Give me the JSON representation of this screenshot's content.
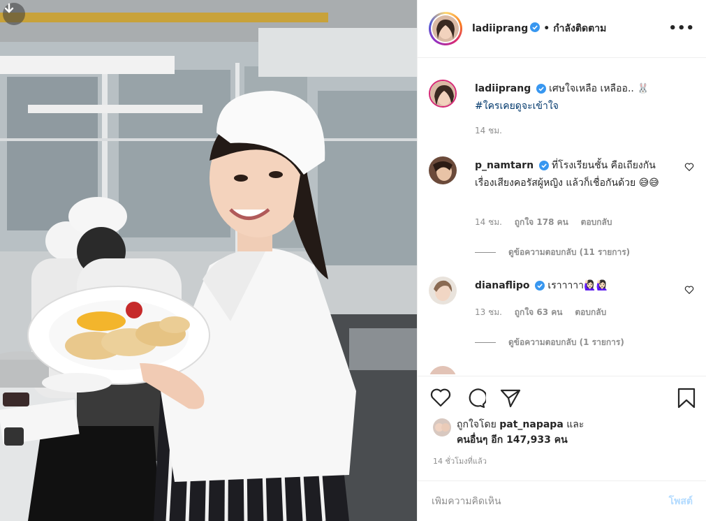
{
  "header": {
    "username": "ladiiprang",
    "separator": "•",
    "follow_status": "กำลังติดตาม",
    "more_label": "•••"
  },
  "caption": {
    "username": "ladiiprang",
    "text": "เศษใจเหลือ เหลืออ.. 🐰",
    "hashtag": "#ใครเคยดูจะเข้าใจ",
    "time": "14 ชม."
  },
  "comments": [
    {
      "username": "p_namtarn",
      "text": "ที่โรงเรียนชั้น คือเถียงกันเรื่องเสียงคอรัสผู้หญิง แล้วก็เชื่อกันด้วย 😅😅",
      "time": "14 ชม.",
      "likes": "ถูกใจ 178 คน",
      "reply": "ตอบกลับ",
      "view_replies": "ดูข้อความตอบกลับ (11 รายการ)"
    },
    {
      "username": "dianaflipo",
      "text": "เราาาาา🙋🏻‍♀️🙋🏻‍♀️",
      "time": "13 ชม.",
      "likes": "ถูกใจ 63 คน",
      "reply": "ตอบกลับ",
      "view_replies": "ดูข้อความตอบกลับ (1 รายการ)"
    }
  ],
  "likes": {
    "prefix": "ถูกใจโดย",
    "user": "pat_napapa",
    "and": "และ",
    "others": "คนอื่นๆ อีก 147,933 คน"
  },
  "posted_ago": "14 ชั่วโมงที่แล้ว",
  "composer": {
    "placeholder": "เพิ่มความคิดเห็น",
    "post_label": "โพสต์"
  },
  "colors": {
    "verified": "#3897f0",
    "link": "#00376b",
    "muted": "#8e8e8e",
    "post_disabled": "#b3dbff"
  }
}
